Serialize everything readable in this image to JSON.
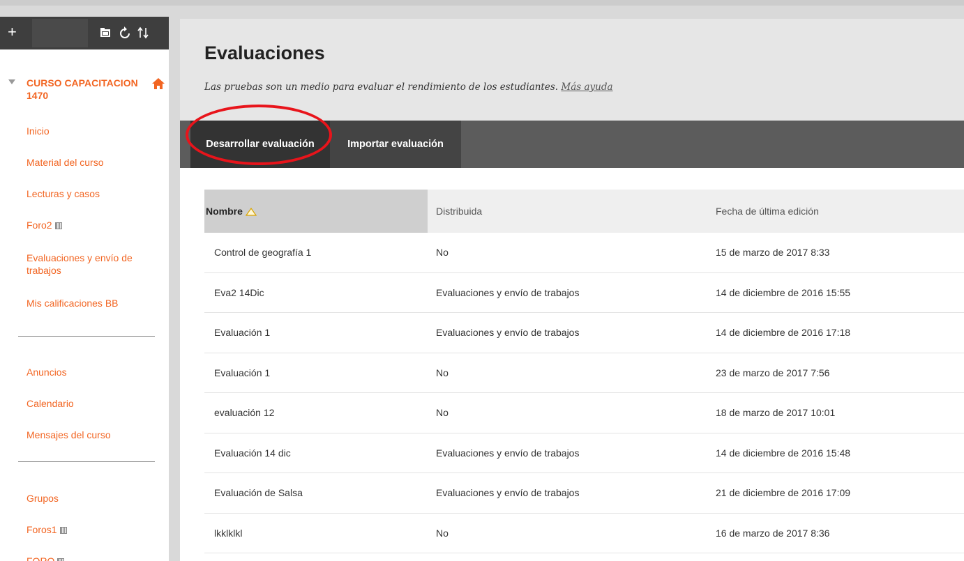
{
  "colors": {
    "accent": "#f26522",
    "highlight": "#e8141b",
    "toolbar_dark": "#3e3e3e",
    "action_bar": "#5c5c5c"
  },
  "sidebar": {
    "toolbar": {
      "add_label": "+",
      "icons": [
        "folder-icon",
        "refresh-icon",
        "sort-icon"
      ]
    },
    "course_name": "CURSO CAPACITACION 1470",
    "groups": [
      [
        {
          "label": "Inicio",
          "grid": false
        },
        {
          "label": "Material del curso",
          "grid": false
        },
        {
          "label": "Lecturas y casos",
          "grid": false
        },
        {
          "label": "Foro2",
          "grid": true
        },
        {
          "label": "Evaluaciones y envío de trabajos",
          "grid": false
        },
        {
          "label": "Mis calificaciones BB",
          "grid": false
        }
      ],
      [
        {
          "label": "Anuncios",
          "grid": false
        },
        {
          "label": "Calendario",
          "grid": false
        },
        {
          "label": "Mensajes del curso",
          "grid": false
        }
      ],
      [
        {
          "label": "Grupos",
          "grid": false
        },
        {
          "label": "Foros1",
          "grid": true
        },
        {
          "label": "FORO",
          "grid": true
        }
      ]
    ]
  },
  "main": {
    "title": "Evaluaciones",
    "description": "Las pruebas son un medio para evaluar el rendimiento de los estudiantes.",
    "help_link": "Más ayuda",
    "actions": {
      "develop": "Desarrollar evaluación",
      "import": "Importar evaluación"
    },
    "table": {
      "headers": {
        "name": "Nombre",
        "deployed": "Distribuida",
        "last_edit": "Fecha de última edición"
      },
      "rows": [
        {
          "name": "Control de geografía 1",
          "deployed": "No",
          "last_edit": "15 de marzo de 2017 8:33"
        },
        {
          "name": "Eva2 14Dic",
          "deployed": "Evaluaciones y envío de trabajos",
          "last_edit": "14 de diciembre de 2016 15:55"
        },
        {
          "name": "Evaluación 1",
          "deployed": "Evaluaciones y envío de trabajos",
          "last_edit": "14 de diciembre de 2016 17:18"
        },
        {
          "name": "Evaluación 1",
          "deployed": "No",
          "last_edit": "23 de marzo de 2017 7:56"
        },
        {
          "name": "evaluación 12",
          "deployed": "No",
          "last_edit": "18 de marzo de 2017 10:01"
        },
        {
          "name": "Evaluación 14 dic",
          "deployed": "Evaluaciones y envío de trabajos",
          "last_edit": "14 de diciembre de 2016 15:48"
        },
        {
          "name": "Evaluación de Salsa",
          "deployed": "Evaluaciones y envío de trabajos",
          "last_edit": "21 de diciembre de 2016 17:09"
        },
        {
          "name": "lkklklkl",
          "deployed": "No",
          "last_edit": "16 de marzo de 2017 8:36"
        }
      ]
    }
  }
}
